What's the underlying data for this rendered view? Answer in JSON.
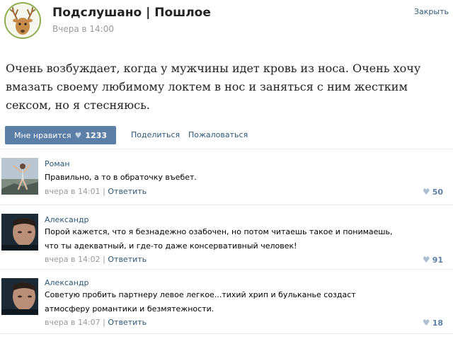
{
  "post": {
    "group_name": "Подслушано | Пошлое",
    "date": "Вчера в 14:00",
    "close_label": "Закрыть",
    "text": "Очень возбуждает, когда у мужчины идет кровь из носа. Очень хочу вмазать своему любимому локтем в нос и заняться с ним жестким сексом, но я стесняюсь.",
    "like_label": "Мне нравится",
    "like_count": "1233",
    "share_label": "Поделиться",
    "report_label": "Пожаловаться"
  },
  "comments": [
    {
      "author": "Роман",
      "text": "Правильно, а то в обраточку въебет.",
      "time": "вчера в 14:01",
      "reply": "Ответить",
      "separator": "|",
      "likes": "50"
    },
    {
      "author": "Александр",
      "text": "Порой кажется, что я безнадежно озабочен, но потом читаешь такое и понимаешь, что ты адекватный, и где-то даже консервативный человек!",
      "time": "вчера в 14:02",
      "reply": "Ответить",
      "separator": "|",
      "likes": "91"
    },
    {
      "author": "Александр",
      "text": "Советую пробить партнеру левое легкое...тихий хрип и бульканье создаст атмосферу романтики и безмятежности.",
      "time": "вчера в 14:07",
      "reply": "Ответить",
      "separator": "|",
      "likes": "18"
    }
  ],
  "icons": {
    "like": "heart-icon",
    "group_avatar": "deer-icon"
  },
  "colors": {
    "accent": "#5b7fa6",
    "link": "#2b587a",
    "muted": "#999999"
  }
}
